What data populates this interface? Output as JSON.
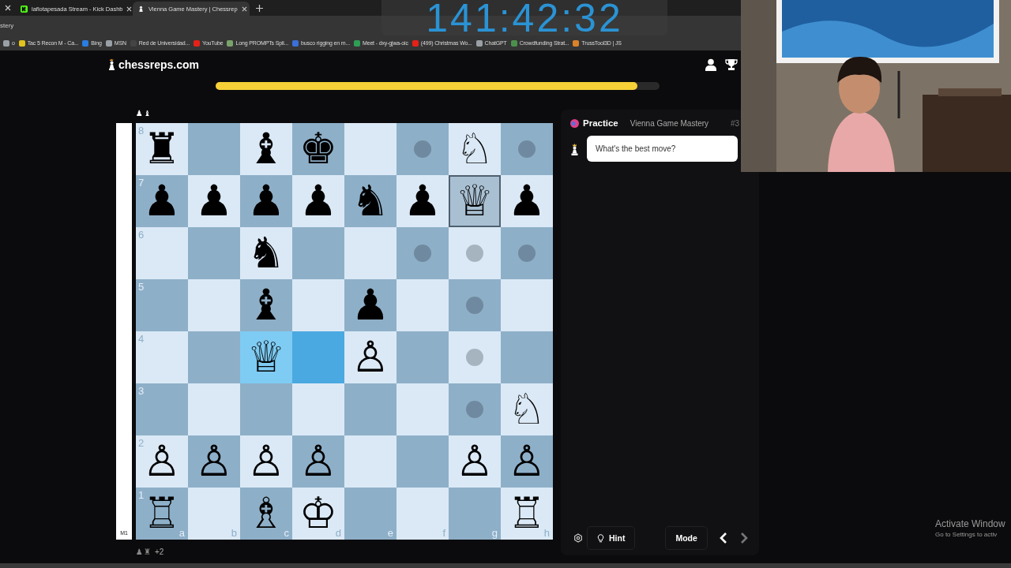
{
  "browser": {
    "tabs": [
      {
        "title": "laflotapesada Stream - Kick Dashb",
        "kind": "kick",
        "selected": false
      },
      {
        "title": "Vienna Game Mastery | Chessrep",
        "kind": "chess",
        "selected": true
      }
    ],
    "address_fragment": "stery",
    "bookmarks": [
      {
        "label": "o",
        "color": "#9aa0a6"
      },
      {
        "label": "Tac 5 Recon M - Ca...",
        "color": "#e2c21c"
      },
      {
        "label": "Bing",
        "color": "#2a7de1"
      },
      {
        "label": "MSN",
        "color": "#9aa0a6"
      },
      {
        "label": "Red de Universidad...",
        "color": "#444444"
      },
      {
        "label": "YouTube",
        "color": "#e62117"
      },
      {
        "label": "Long PROMPTs Spli...",
        "color": "#7aa36b"
      },
      {
        "label": "busco rigging en m...",
        "color": "#3a6fd8"
      },
      {
        "label": "Meet - dxy-gjwa-oic",
        "color": "#2e9e55"
      },
      {
        "label": "(499) Christmas Wo...",
        "color": "#e62117"
      },
      {
        "label": "ChatGPT",
        "color": "#9aa0a6"
      },
      {
        "label": "Crowdfunding Strat...",
        "color": "#4c8f4c"
      },
      {
        "label": "TrussTool3D | JS",
        "color": "#d9822b"
      }
    ]
  },
  "timer": {
    "text": "141:42:32"
  },
  "site": {
    "logo": "chessreps.com",
    "progress": {
      "level": 0.95
    }
  },
  "board": {
    "eval_bar": {
      "label": "M1",
      "level": 1
    },
    "captured_top": {
      "pieces": [
        "♟",
        "♝"
      ]
    },
    "captured_bottom": {
      "pieces": [
        "♟",
        "♜"
      ],
      "advantage": "+2"
    },
    "ranks": [
      {
        "label": "8",
        "squares": [
          {
            "piece": "♜",
            "hint": false,
            "selected": false
          },
          {
            "hint": false,
            "selected": false
          },
          {
            "piece": "♝",
            "hint": false,
            "selected": false
          },
          {
            "piece": "♚",
            "hint": false,
            "selected": false
          },
          {
            "hint": false,
            "selected": false
          },
          {
            "hint": true,
            "selected": false
          },
          {
            "piece": "♘",
            "hint": false,
            "selected": false
          },
          {
            "hint": true,
            "selected": false
          }
        ]
      },
      {
        "label": "7",
        "squares": [
          {
            "piece": "♟",
            "hint": false,
            "selected": false
          },
          {
            "piece": "♟",
            "hint": false,
            "selected": false
          },
          {
            "piece": "♟",
            "hint": false,
            "selected": false
          },
          {
            "piece": "♟",
            "hint": false,
            "selected": false
          },
          {
            "piece": "♞",
            "hint": false,
            "selected": false
          },
          {
            "piece": "♟",
            "hint": false,
            "selected": false
          },
          {
            "piece": "♕",
            "hint": false,
            "selected": true
          },
          {
            "piece": "♟",
            "hint": false,
            "selected": false
          }
        ]
      },
      {
        "label": "6",
        "squares": [
          {
            "hint": false,
            "selected": false
          },
          {
            "hint": false,
            "selected": false
          },
          {
            "piece": "♞",
            "hint": false,
            "selected": false
          },
          {
            "hint": false,
            "selected": false
          },
          {
            "hint": false,
            "selected": false
          },
          {
            "hint": true,
            "selected": false
          },
          {
            "hint": true,
            "selected": false
          },
          {
            "hint": true,
            "selected": false
          }
        ]
      },
      {
        "label": "5",
        "squares": [
          {
            "hint": false,
            "selected": false
          },
          {
            "hint": false,
            "selected": false
          },
          {
            "piece": "♝",
            "hint": false,
            "selected": false
          },
          {
            "hint": false,
            "selected": false
          },
          {
            "piece": "♟",
            "hint": false,
            "selected": false
          },
          {
            "hint": false,
            "selected": false
          },
          {
            "hint": true,
            "selected": false
          },
          {
            "hint": false,
            "selected": false
          }
        ]
      },
      {
        "label": "4",
        "squares": [
          {
            "hint": false,
            "selected": false
          },
          {
            "hint": false,
            "selected": false
          },
          {
            "piece": "♕",
            "hint": false,
            "selected": false,
            "color": "#7ecbf3"
          },
          {
            "hint": false,
            "selected": false,
            "color": "#4ba9e1"
          },
          {
            "piece": "♙",
            "hint": false,
            "selected": false
          },
          {
            "hint": false,
            "selected": false
          },
          {
            "hint": true,
            "selected": false
          },
          {
            "hint": false,
            "selected": false
          }
        ]
      },
      {
        "label": "3",
        "squares": [
          {
            "hint": false,
            "selected": false
          },
          {
            "hint": false,
            "selected": false
          },
          {
            "hint": false,
            "selected": false
          },
          {
            "hint": false,
            "selected": false
          },
          {
            "hint": false,
            "selected": false
          },
          {
            "hint": false,
            "selected": false
          },
          {
            "hint": true,
            "selected": false
          },
          {
            "piece": "♘",
            "hint": false,
            "selected": false
          }
        ]
      },
      {
        "label": "2",
        "squares": [
          {
            "piece": "♙",
            "hint": false,
            "selected": false
          },
          {
            "piece": "♙",
            "hint": false,
            "selected": false
          },
          {
            "piece": "♙",
            "hint": false,
            "selected": false
          },
          {
            "piece": "♙",
            "hint": false,
            "selected": false
          },
          {
            "hint": false,
            "selected": false
          },
          {
            "hint": false,
            "selected": false
          },
          {
            "piece": "♙",
            "hint": false,
            "selected": false
          },
          {
            "piece": "♙",
            "hint": false,
            "selected": false
          }
        ]
      },
      {
        "label": "1",
        "squares": [
          {
            "piece": "♖",
            "file_label": "a",
            "hint": false,
            "selected": false
          },
          {
            "file_label": "b",
            "hint": false,
            "selected": false
          },
          {
            "piece": "♗",
            "file_label": "c",
            "hint": false,
            "selected": false
          },
          {
            "piece": "♔",
            "file_label": "d",
            "hint": false,
            "selected": false
          },
          {
            "file_label": "e",
            "hint": false,
            "selected": false
          },
          {
            "file_label": "f",
            "hint": false,
            "selected": false
          },
          {
            "file_label": "g",
            "hint": false,
            "selected": false
          },
          {
            "piece": "♖",
            "file_label": "h",
            "hint": false,
            "selected": false
          }
        ]
      }
    ]
  },
  "panel": {
    "mode_label": "Practice",
    "course": "Vienna Game Mastery",
    "number": "#3",
    "prompt": "What's the best move?",
    "buttons": [
      {
        "label": "Hint",
        "kind": "hint"
      },
      {
        "label": "Mode",
        "kind": "mode"
      }
    ],
    "nav": [
      {
        "kind": "prev",
        "disabled": false
      },
      {
        "kind": "next",
        "disabled": true
      }
    ]
  },
  "os_notice": {
    "title": "Activate Window",
    "subtitle": "Go to Settings to activ"
  }
}
